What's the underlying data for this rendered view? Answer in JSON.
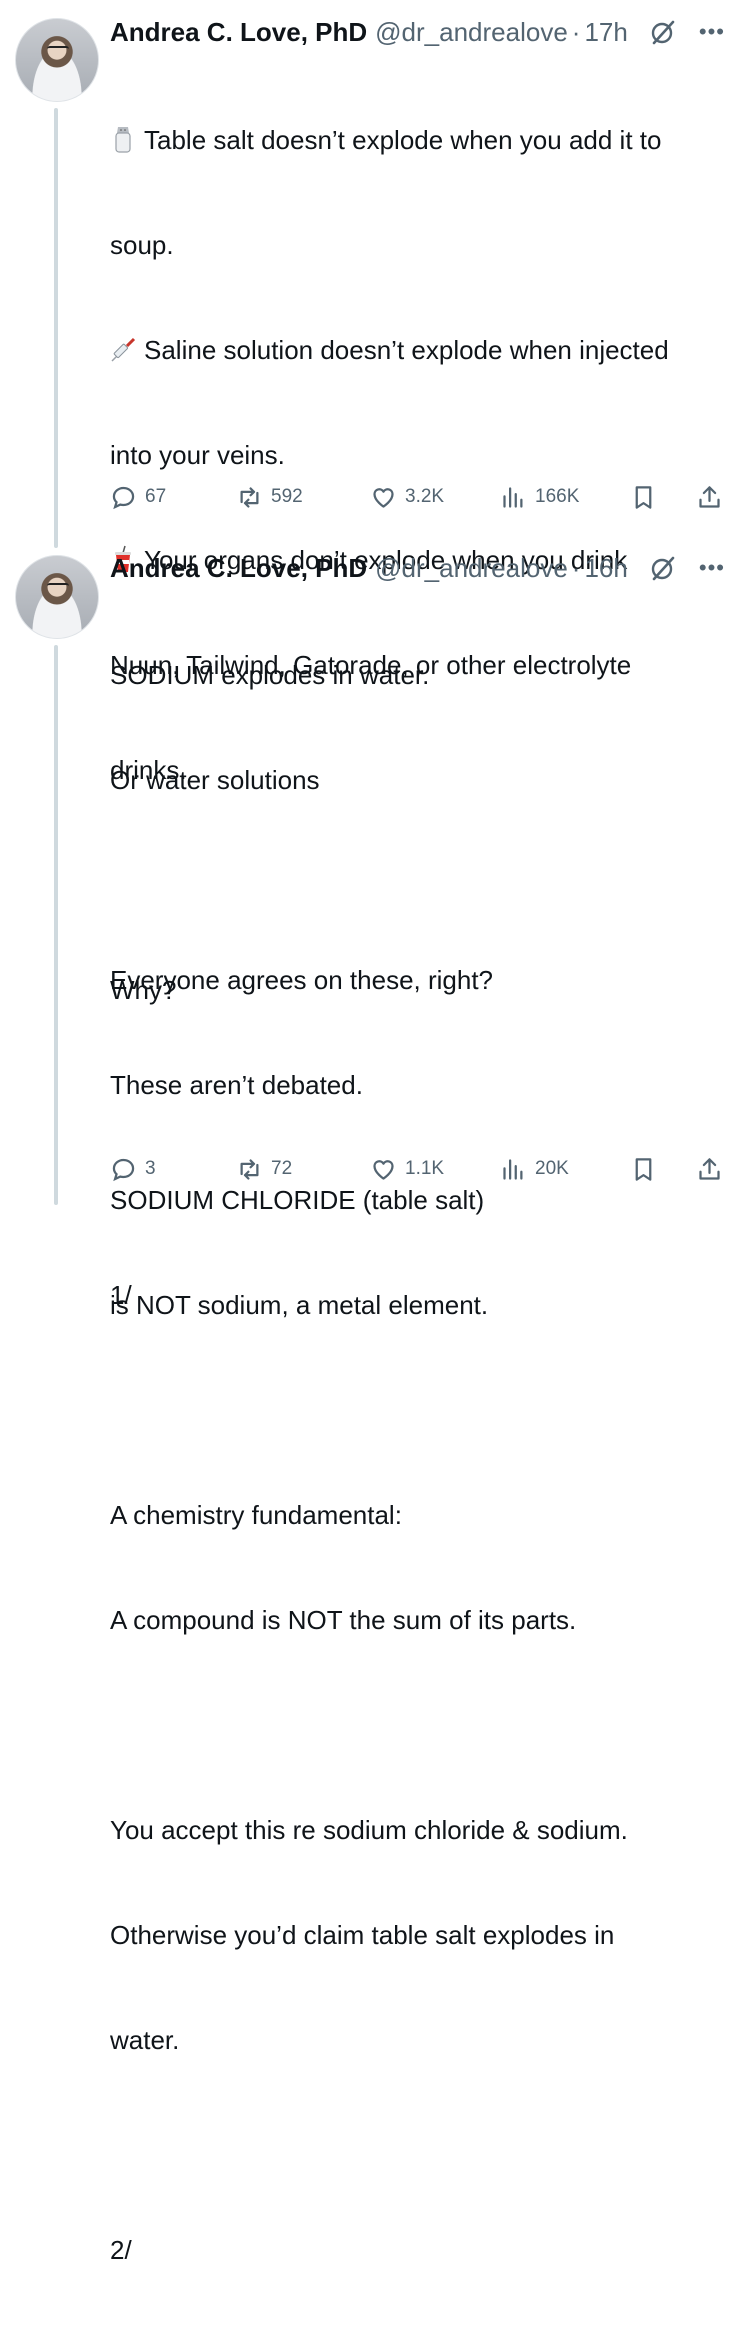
{
  "tweets": [
    {
      "author_name": "Andrea C. Love, PhD",
      "handle": "@dr_andrealove",
      "separator": "·",
      "time": "17h",
      "lines": {
        "l1": "Table salt doesn’t explode when you add it to",
        "l2": "soup.",
        "l3": "Saline solution doesn’t explode when injected",
        "l4": "into your veins.",
        "l5": "Your organs don’t explode when you drink",
        "l6": "Nuun, Tailwind, Gatorade, or other electrolyte",
        "l7": "drinks.",
        "l8": "Everyone agrees on these, right?",
        "l9": "These aren’t debated.",
        "l10": "1/"
      },
      "icons": [
        "salt-shaker-icon",
        "syringe-icon",
        "cup-with-straw-icon"
      ],
      "stats": {
        "replies": "67",
        "reposts": "592",
        "likes": "3.2K",
        "views": "166K"
      }
    },
    {
      "author_name": "Andrea C. Love, PhD",
      "handle": "@dr_andrealove",
      "separator": "·",
      "time": "16h",
      "lines": {
        "l1": "SODIUM explodes in water.",
        "l2": "Or water solutions",
        "l3": "Why?",
        "l4": "SODIUM CHLORIDE (table salt)",
        "l5": "is NOT sodium, a metal element.",
        "l6": "A chemistry fundamental:",
        "l7": "A compound is NOT the sum of its parts.",
        "l8": "You accept this re sodium chloride & sodium.",
        "l9": "Otherwise you’d claim table salt explodes in",
        "l10": "water.",
        "l11": "2/"
      },
      "stats": {
        "replies": "3",
        "reposts": "72",
        "likes": "1.1K",
        "views": "20K"
      }
    }
  ],
  "colors": {
    "text": "#0f1419",
    "secondary": "#536471",
    "thread_line": "#cfd9de"
  }
}
